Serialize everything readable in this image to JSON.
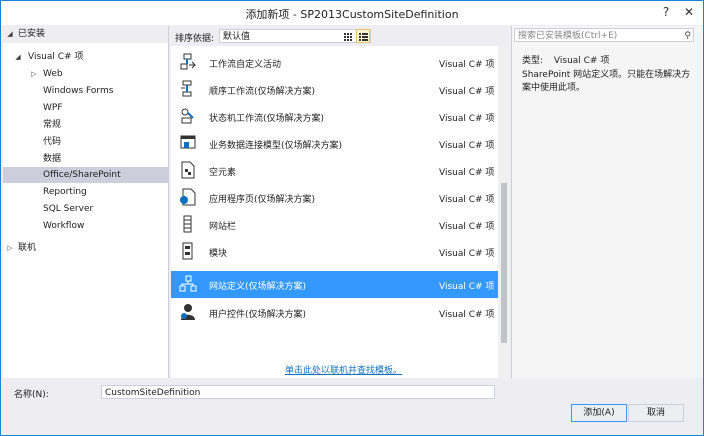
{
  "window": {
    "title": "添加新项 - SP2013CustomSiteDefinition",
    "help_glyph": "?",
    "close_glyph": "✕"
  },
  "left_panel": {
    "installed_label": "已安装",
    "tree": [
      {
        "label": "Visual C# 项",
        "arrow": "◢"
      },
      {
        "label": "Web",
        "arrow": "▷"
      },
      {
        "label": "Windows Forms",
        "arrow": ""
      },
      {
        "label": "WPF",
        "arrow": ""
      },
      {
        "label": "常规",
        "arrow": ""
      },
      {
        "label": "代码",
        "arrow": ""
      },
      {
        "label": "数据",
        "arrow": ""
      },
      {
        "label": "Office/SharePoint",
        "arrow": "",
        "selected": true
      },
      {
        "label": "Reporting",
        "arrow": ""
      },
      {
        "label": "SQL Server",
        "arrow": ""
      },
      {
        "label": "Workflow",
        "arrow": ""
      }
    ],
    "online_label": "联机"
  },
  "toolbar": {
    "sort_label": "排序依据:",
    "sort_value": "默认值"
  },
  "templates": [
    {
      "name": "工作流自定义活动",
      "lang": "Visual C# 项",
      "icon": "workflow-activity-icon"
    },
    {
      "name": "顺序工作流(仅场解决方案)",
      "lang": "Visual C# 项",
      "icon": "sequential-workflow-icon"
    },
    {
      "name": "状态机工作流(仅场解决方案)",
      "lang": "Visual C# 项",
      "icon": "state-machine-workflow-icon"
    },
    {
      "name": "业务数据连接模型(仅场解决方案)",
      "lang": "Visual C# 项",
      "icon": "bdc-model-icon"
    },
    {
      "name": "空元素",
      "lang": "Visual C# 项",
      "icon": "empty-element-icon"
    },
    {
      "name": "应用程序页(仅场解决方案)",
      "lang": "Visual C# 项",
      "icon": "application-page-icon"
    },
    {
      "name": "网站栏",
      "lang": "Visual C# 项",
      "icon": "site-column-icon"
    },
    {
      "name": "模块",
      "lang": "Visual C# 项",
      "icon": "module-icon"
    },
    {
      "name": "网站定义(仅场解决方案)",
      "lang": "Visual C# 项",
      "icon": "site-definition-icon",
      "selected": true
    },
    {
      "name": "用户控件(仅场解决方案)",
      "lang": "Visual C# 项",
      "icon": "user-control-icon"
    }
  ],
  "online_link": "单击此处以联机并查找模板。",
  "details": {
    "search_placeholder": "搜索已安装模板(Ctrl+E)",
    "type_label": "类型:",
    "type_value": "Visual C# 项",
    "description": "SharePoint 网站定义项。只能在场解决方案中使用此项。"
  },
  "bottom": {
    "name_label": "名称(N):",
    "name_value": "CustomSiteDefinition",
    "add_button": "添加(A)",
    "cancel_button": "取消"
  },
  "colors": {
    "accent": "#3399ff",
    "link": "#0e70c0",
    "window_border": "#1883d7"
  }
}
